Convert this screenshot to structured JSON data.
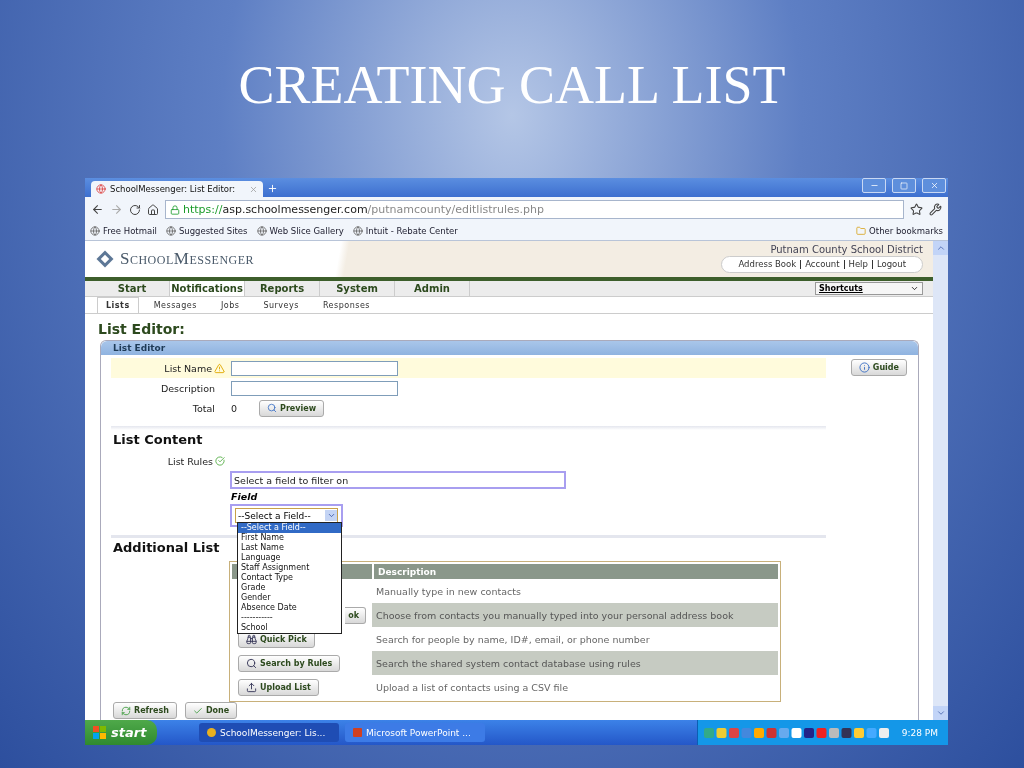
{
  "slide": {
    "title": "CREATING CALL LIST"
  },
  "browser": {
    "tabs": [
      {
        "label": "SchoolMessenger: List Editor:",
        "selected": true
      }
    ],
    "url": {
      "scheme": "https://",
      "host": "asp.schoolmessenger.com",
      "path": "/putnamcounty/editlistrules.php"
    },
    "bookmarks": [
      "Free Hotmail",
      "Suggested Sites",
      "Web Slice Gallery",
      "Intuit - Rebate Center"
    ],
    "other_bookmarks": "Other bookmarks"
  },
  "page": {
    "logo": "SchoolMessenger",
    "district": "Putnam County School District",
    "links": [
      "Address Book",
      "Account",
      "Help",
      "Logout"
    ],
    "nav": [
      {
        "label": "Start",
        "selected": false
      },
      {
        "label": "Notifications",
        "selected": true
      },
      {
        "label": "Reports",
        "selected": false
      },
      {
        "label": "System",
        "selected": false
      },
      {
        "label": "Admin",
        "selected": false
      }
    ],
    "shortcuts": "Shortcuts",
    "subnav": [
      {
        "label": "Lists",
        "selected": true
      },
      {
        "label": "Messages",
        "selected": false
      },
      {
        "label": "Jobs",
        "selected": false
      },
      {
        "label": "Surveys",
        "selected": false
      },
      {
        "label": "Responses",
        "selected": false
      }
    ],
    "heading": "List Editor:",
    "panel": {
      "title": "List Editor",
      "guide": "Guide",
      "list_name": {
        "label": "List Name"
      },
      "description": {
        "label": "Description"
      },
      "total": {
        "label": "Total",
        "value": "0"
      },
      "preview": "Preview",
      "content_title": "List Content",
      "rules_label": "List Rules",
      "filter_prompt": "Select a field to filter on",
      "field_label": "Field",
      "select": {
        "value": "--Select a Field--",
        "expanded": true,
        "options": [
          {
            "label": "--Select a Field--",
            "selected": true
          },
          {
            "label": "First Name",
            "selected": false
          },
          {
            "label": "Last Name",
            "selected": false
          },
          {
            "label": "Language",
            "selected": false
          },
          {
            "label": "Staff Assignment",
            "selected": false
          },
          {
            "label": "Contact Type",
            "selected": false
          },
          {
            "label": "Grade",
            "selected": false
          },
          {
            "label": "Gender",
            "selected": false
          },
          {
            "label": "Absence Date",
            "selected": false
          },
          {
            "label": "-----------",
            "selected": false
          },
          {
            "label": "School",
            "selected": false
          }
        ]
      },
      "additional_title": "Additional List",
      "table": {
        "description_header": "Description",
        "rows": [
          {
            "kind": "none",
            "description": "Manually type in new contacts"
          },
          {
            "kind": "book",
            "button": "ok",
            "description": "Choose from contacts you manually typed into your personal address book"
          },
          {
            "kind": "pick",
            "button": "Quick Pick",
            "description": "Search for people by name, ID#, email, or phone number"
          },
          {
            "kind": "rules",
            "button": "Search by Rules",
            "description": "Search the shared system contact database using rules"
          },
          {
            "kind": "upload",
            "button": "Upload List",
            "description": "Upload a list of contacts using a CSV file"
          }
        ]
      },
      "actions": [
        {
          "kind": "refresh",
          "label": "Refresh"
        },
        {
          "kind": "done",
          "label": "Done"
        }
      ]
    }
  },
  "taskbar": {
    "start": "start",
    "tasks": [
      {
        "kind": "browser",
        "label": "SchoolMessenger: Lis...",
        "selected": true
      },
      {
        "kind": "slides",
        "label": "Microsoft PowerPoint ...",
        "selected": false
      }
    ],
    "time": "9:28 PM"
  }
}
